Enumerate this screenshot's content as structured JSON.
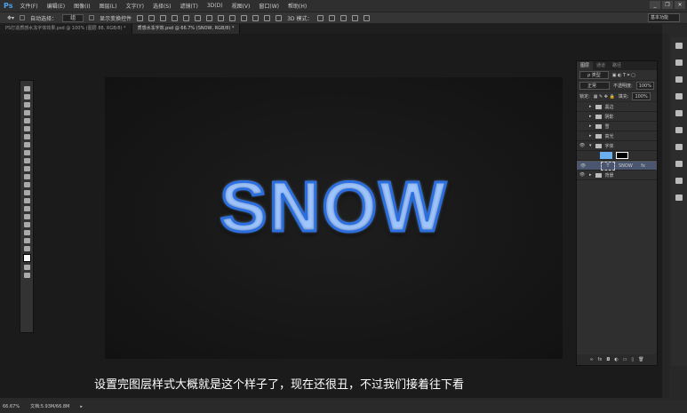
{
  "app": {
    "logo": "Ps",
    "menu": [
      "文件(F)",
      "编辑(E)",
      "图像(I)",
      "图层(L)",
      "文字(Y)",
      "选择(S)",
      "滤镜(T)",
      "3D(D)",
      "视图(V)",
      "窗口(W)",
      "帮助(H)"
    ],
    "window_buttons": [
      "_",
      "❐",
      "✕"
    ]
  },
  "options": {
    "auto_select": "自动选择：",
    "auto_select_value": "组",
    "show_transform": "显示变换控件",
    "mode3d": "3D 模式：",
    "workspace": "基本功能"
  },
  "tabs": [
    {
      "label": "PS打造质感水冻字体效果.psd @ 100% (图层 88, RGB/8) *"
    },
    {
      "label": "质感水冻字效.psd @ 66.7% (SNOW, RGB/8) *"
    }
  ],
  "canvas": {
    "text": "SNOW"
  },
  "caption": "设置完图层样式大概就是这个样子了，现在还很丑，不过我们接着往下看",
  "status": {
    "zoom": "66.67%",
    "doc": "文档:5.93M/66.8M"
  },
  "layers_panel": {
    "tabs": [
      "图层",
      "通道",
      "路径"
    ],
    "filter": "ρ 类型",
    "blend": "正常",
    "opacity_label": "不透明度:",
    "opacity": "100%",
    "lock_label": "锁定:",
    "fill_label": "填充:",
    "fill": "100%",
    "layers": [
      {
        "name": "黑边",
        "visible": false,
        "type": "group"
      },
      {
        "name": "阴影",
        "visible": false,
        "type": "group"
      },
      {
        "name": "雪",
        "visible": false,
        "type": "group"
      },
      {
        "name": "高光",
        "visible": false,
        "type": "group"
      },
      {
        "name": "字体",
        "visible": true,
        "type": "group-open"
      },
      {
        "name": "",
        "visible": false,
        "type": "mask"
      },
      {
        "name": "SNOW",
        "visible": true,
        "type": "text"
      },
      {
        "name": "背景",
        "visible": true,
        "type": "group"
      }
    ],
    "footer_icons": [
      "∞",
      "fx",
      "◘",
      "◐",
      "▭",
      "▯",
      "🗑"
    ]
  }
}
